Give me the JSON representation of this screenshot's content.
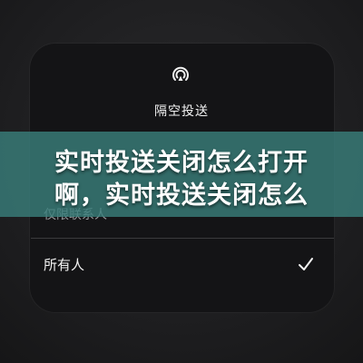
{
  "airdrop_panel": {
    "icon": "airdrop-icon",
    "title": "隔空投送",
    "options": [
      {
        "label": "仅限联系人",
        "selected": false
      },
      {
        "label": "所有人",
        "selected": true
      }
    ]
  },
  "overlay_banner": {
    "line1": "实时投送关闭怎么打开",
    "line2": "啊，实时投送关闭怎么"
  }
}
